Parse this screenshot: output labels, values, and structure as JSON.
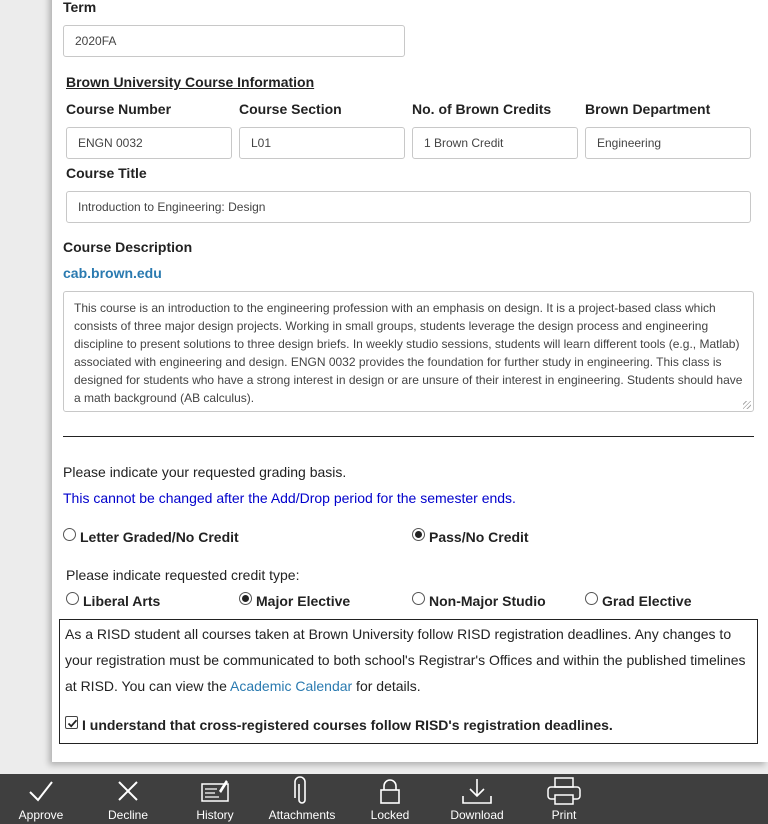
{
  "term": {
    "label": "Term",
    "value": "2020FA"
  },
  "brown_info": {
    "title": "Brown University Course Information",
    "course_number_label": "Course Number",
    "course_number": "ENGN 0032",
    "course_section_label": "Course Section",
    "course_section": "L01",
    "credits_label": "No. of Brown Credits",
    "credits": "1 Brown Credit",
    "department_label": "Brown Department",
    "department": "Engineering",
    "course_title_label": "Course Title",
    "course_title": "Introduction to Engineering: Design"
  },
  "description": {
    "label": "Course Description",
    "link": "cab.brown.edu",
    "text": "This course is an introduction to the engineering profession with an emphasis on design. It is a project-based class which consists of three major design projects. Working in small groups, students leverage the design process and engineering discipline to present solutions to three design briefs. In weekly studio sessions, students will learn different tools (e.g., Matlab) associated with engineering and design. ENGN 0032 provides the foundation for further study in engineering. This class is designed for students who have a strong interest in design or are unsure of their interest in engineering. Students should have a math background (AB calculus)."
  },
  "grading": {
    "prompt": "Please indicate your requested grading basis.",
    "warning": "This cannot be changed after the Add/Drop period for the semester ends.",
    "options": [
      "Letter Graded/No Credit",
      "Pass/No Credit"
    ],
    "selected": "Pass/No Credit"
  },
  "credit_type": {
    "prompt": "Please indicate requested credit type:",
    "options": [
      "Liberal Arts",
      "Major Elective",
      "Non-Major Studio",
      "Grad Elective"
    ],
    "selected": "Major Elective"
  },
  "notice": {
    "text_before": "As a RISD student all courses taken at Brown University follow RISD registration deadlines. Any changes to your registration must be communicated to both school's Registrar's Offices and within the published timelines at RISD. You can view the ",
    "link": "Academic Calendar",
    "text_after": " for details.",
    "ack_label": "I understand that cross-registered courses follow RISD's registration deadlines.",
    "ack_checked": true
  },
  "toolbar": {
    "approve": "Approve",
    "decline": "Decline",
    "history": "History",
    "attachments": "Attachments",
    "locked": "Locked",
    "download": "Download",
    "print": "Print"
  },
  "colors": {
    "toolbar_bg": "#3f3f3f",
    "link": "#2a7ab0",
    "warning": "#0000cc"
  }
}
